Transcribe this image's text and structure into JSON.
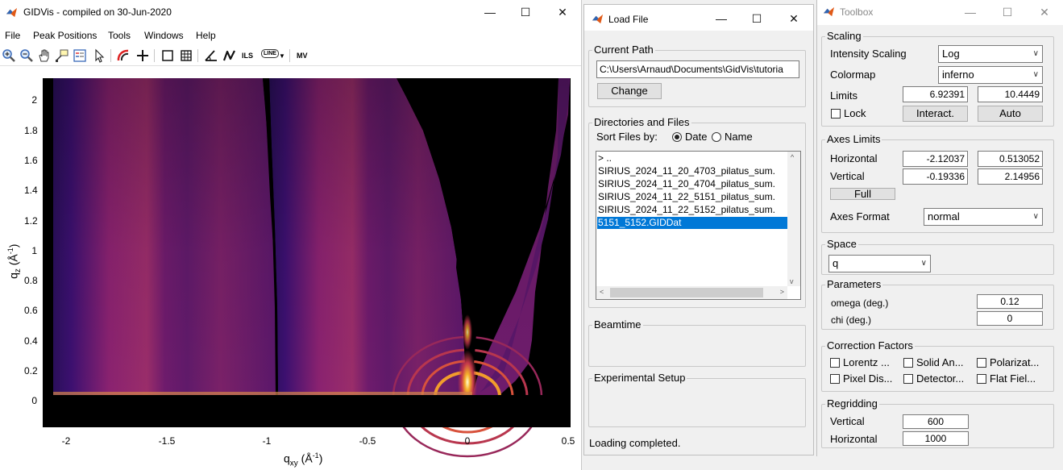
{
  "gidvis": {
    "title": "GIDVis - compiled on 30-Jun-2020",
    "menu": [
      "File",
      "Peak Positions",
      "Tools",
      "Windows",
      "Help"
    ],
    "toolbar_text": {
      "ils": "ILS",
      "line": "LINE",
      "mv": "MV"
    },
    "plot": {
      "ylabel_main": "q",
      "ylabel_sub": "z",
      "ylabel_unit": " (Å",
      "ylabel_sup": "-1",
      "ylabel_close": ")",
      "xlabel_main": "q",
      "xlabel_sub": "xy",
      "xlabel_unit": " (Å",
      "xlabel_sup": "-1",
      "xlabel_close": ")",
      "yticks": [
        "2",
        "1.8",
        "1.6",
        "1.4",
        "1.2",
        "1",
        "0.8",
        "0.6",
        "0.4",
        "0.2",
        "0"
      ],
      "xticks": [
        "-2",
        "-1.5",
        "-1",
        "-0.5",
        "0",
        "0.5"
      ]
    }
  },
  "loadfile": {
    "title": "Load File",
    "current_path_label": "Current Path",
    "path": "C:\\Users\\Arnaud\\Documents\\GidVis\\tutoria",
    "change_button": "Change",
    "dirs_label": "Directories and Files",
    "sort_label": "Sort Files by:",
    "sort_date": "Date",
    "sort_name": "Name",
    "files": [
      "> ..",
      "SIRIUS_2024_11_20_4703_pilatus_sum.",
      "SIRIUS_2024_11_20_4704_pilatus_sum.",
      "SIRIUS_2024_11_22_5151_pilatus_sum.",
      "SIRIUS_2024_11_22_5152_pilatus_sum.",
      "5151_5152.GIDDat"
    ],
    "beamtime_label": "Beamtime",
    "setup_label": "Experimental Setup",
    "status": "Loading completed."
  },
  "toolbox": {
    "title": "Toolbox",
    "scaling": {
      "label": "Scaling",
      "intensity_label": "Intensity Scaling",
      "intensity_value": "Log",
      "colormap_label": "Colormap",
      "colormap_value": "inferno",
      "limits_label": "Limits",
      "limit_min": "6.92391",
      "limit_max": "10.4449",
      "lock_label": "Lock",
      "interact_button": "Interact.",
      "auto_button": "Auto"
    },
    "axes": {
      "label": "Axes Limits",
      "horizontal_label": "Horizontal",
      "h_min": "-2.12037",
      "h_max": "0.513052",
      "vertical_label": "Vertical",
      "v_min": "-0.19336",
      "v_max": "2.14956",
      "full_button": "Full",
      "format_label": "Axes Format",
      "format_value": "normal"
    },
    "space": {
      "label": "Space",
      "value": "q"
    },
    "parameters": {
      "label": "Parameters",
      "omega_label": "omega (deg.)",
      "omega_value": "0.12",
      "chi_label": "chi (deg.)",
      "chi_value": "0"
    },
    "corrections": {
      "label": "Correction Factors",
      "items": [
        "Lorentz ...",
        "Solid An...",
        "Polarizat...",
        "Pixel Dis...",
        "Detector...",
        "Flat Fiel..."
      ]
    },
    "regridding": {
      "label": "Regridding",
      "vertical_label": "Vertical",
      "vertical_value": "600",
      "horizontal_label": "Horizontal",
      "horizontal_value": "1000"
    }
  }
}
